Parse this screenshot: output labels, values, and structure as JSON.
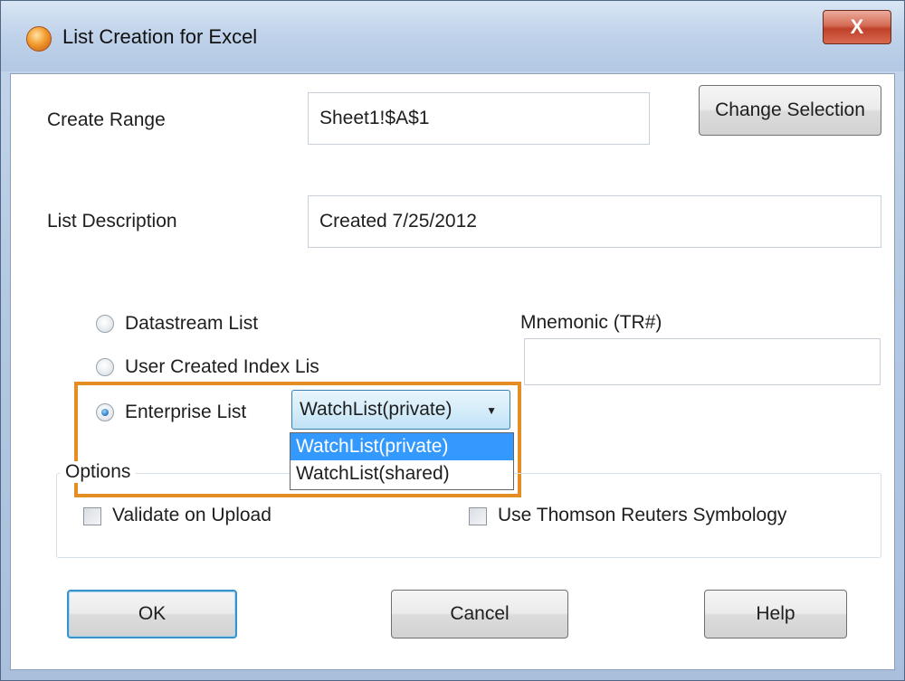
{
  "window": {
    "title": "List Creation for Excel",
    "close_label": "X"
  },
  "form": {
    "create_range_label": "Create Range",
    "create_range_value": "Sheet1!$A$1",
    "change_selection_label": "Change Selection",
    "list_description_label": "List Description",
    "list_description_value": "Created 7/25/2012",
    "mnemonic_label": "Mnemonic (TR#)",
    "mnemonic_value": ""
  },
  "list_types": [
    {
      "label": "Datastream List",
      "checked": false
    },
    {
      "label": "User Created Index Lis",
      "checked": false
    },
    {
      "label": "Enterprise List",
      "checked": true
    }
  ],
  "enterprise_combo": {
    "selected": "WatchList(private)",
    "options": [
      "WatchList(private)",
      "WatchList(shared)"
    ]
  },
  "options": {
    "legend": "Options",
    "validate_label": "Validate on Upload",
    "validate_checked": false,
    "symbology_label": "Use Thomson Reuters Symbology",
    "symbology_checked": false
  },
  "buttons": {
    "ok": "OK",
    "cancel": "Cancel",
    "help": "Help"
  },
  "colors": {
    "highlight": "#e48d23",
    "selection": "#3399ff"
  }
}
